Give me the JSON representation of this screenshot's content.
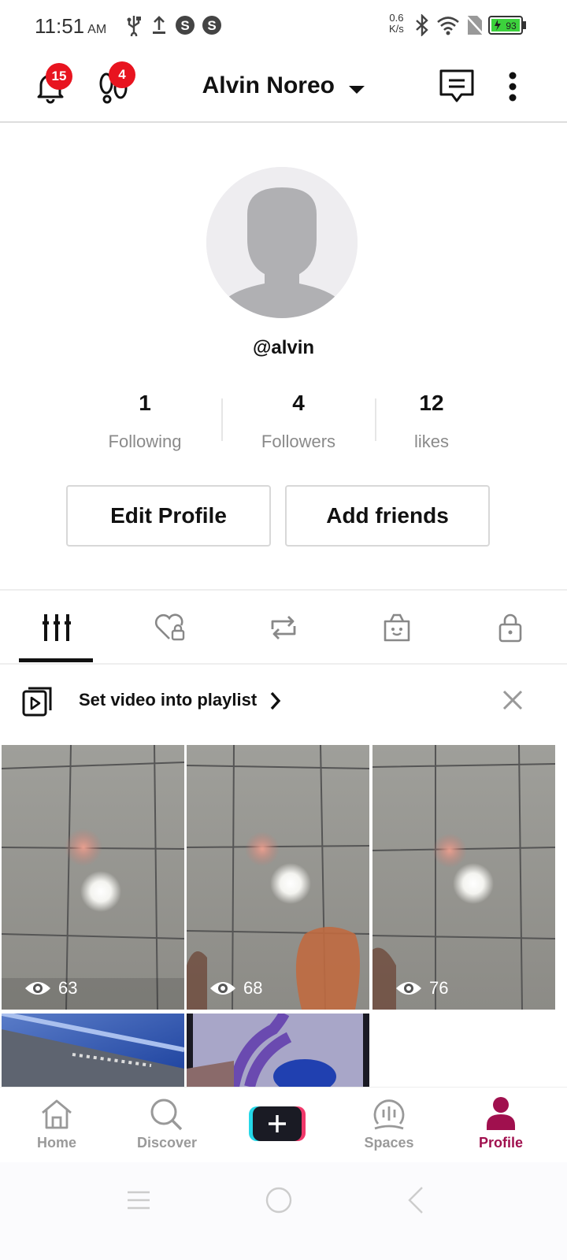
{
  "status_bar": {
    "time": "11:51",
    "ampm": "AM",
    "net_speed_value": "0.6",
    "net_speed_unit": "K/s",
    "battery": "93",
    "icons": [
      "usb-icon",
      "upload-icon",
      "skype-icon",
      "skype-icon",
      "bluetooth-icon",
      "wifi-icon",
      "no-sim-icon",
      "battery-icon"
    ]
  },
  "header": {
    "notifications_badge": "15",
    "footprints_badge": "4",
    "username": "Alvin Noreo",
    "icons": [
      "bell-icon",
      "footprints-icon",
      "inbox-icon",
      "more-icon"
    ]
  },
  "profile": {
    "handle": "@alvin",
    "stats": [
      {
        "value": "1",
        "label": "Following"
      },
      {
        "value": "4",
        "label": "Followers"
      },
      {
        "value": "12",
        "label": "likes"
      }
    ],
    "edit_button": "Edit Profile",
    "add_friends_button": "Add friends"
  },
  "tabs": [
    "videos-grid-icon",
    "liked-private-icon",
    "repost-icon",
    "shop-bag-icon",
    "private-lock-icon"
  ],
  "playlist": {
    "label": "Set video into playlist"
  },
  "videos": [
    {
      "views": "63"
    },
    {
      "views": "68"
    },
    {
      "views": "76"
    },
    {
      "views": ""
    },
    {
      "views": ""
    }
  ],
  "nav": {
    "items": [
      {
        "label": "Home",
        "icon": "home-icon"
      },
      {
        "label": "Discover",
        "icon": "search-icon"
      },
      {
        "label": "",
        "icon": "create-plus-icon"
      },
      {
        "label": "Spaces",
        "icon": "spaces-icon"
      },
      {
        "label": "Profile",
        "icon": "profile-icon"
      }
    ],
    "active": "Profile",
    "accent": "#a0104e"
  },
  "colors": {
    "badge": "#e8141f",
    "muted": "#8a8a8a",
    "battery": "#3cd23c"
  }
}
